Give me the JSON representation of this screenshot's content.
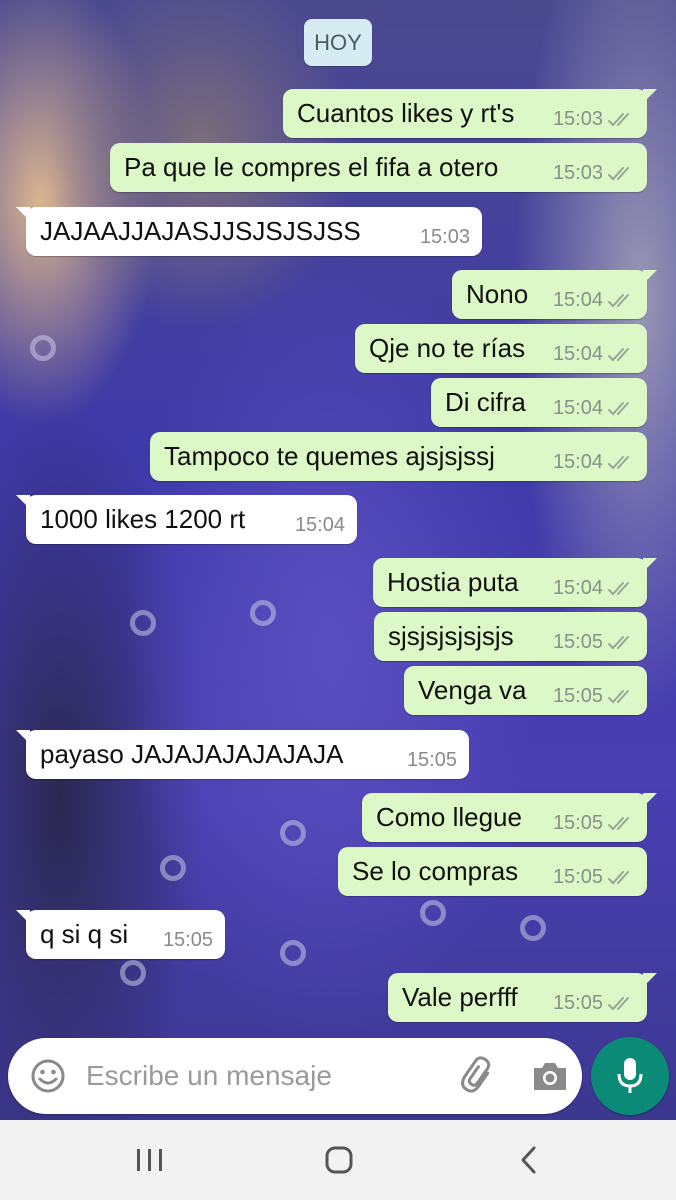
{
  "date_chip": "HOY",
  "messages": [
    {
      "dir": "out",
      "text": "Cuantos likes y rt's",
      "time": "15:03"
    },
    {
      "dir": "out",
      "text": "Pa que le compres el fifa a otero",
      "time": "15:03"
    },
    {
      "dir": "in",
      "text": "JAJAAJJAJASJJSJSJSJSS",
      "time": "15:03"
    },
    {
      "dir": "out",
      "text": "Nono",
      "time": "15:04"
    },
    {
      "dir": "out",
      "text": "Qje no te rías",
      "time": "15:04"
    },
    {
      "dir": "out",
      "text": "Di cifra",
      "time": "15:04"
    },
    {
      "dir": "out",
      "text": "Tampoco te quemes ajsjsjssj",
      "time": "15:04"
    },
    {
      "dir": "in",
      "text": "1000 likes 1200 rt",
      "time": "15:04"
    },
    {
      "dir": "out",
      "text": "Hostia puta",
      "time": "15:04"
    },
    {
      "dir": "out",
      "text": "sjsjsjsjsjsjs",
      "time": "15:05"
    },
    {
      "dir": "out",
      "text": "Venga va",
      "time": "15:05"
    },
    {
      "dir": "in",
      "text": "payaso JAJAJAJAJAJAJA",
      "time": "15:05"
    },
    {
      "dir": "out",
      "text": "Como llegue",
      "time": "15:05"
    },
    {
      "dir": "out",
      "text": "Se lo compras",
      "time": "15:05"
    },
    {
      "dir": "in",
      "text": "q si q si",
      "time": "15:05"
    },
    {
      "dir": "out",
      "text": "Vale perfff",
      "time": "15:05"
    }
  ],
  "composer": {
    "placeholder": "Escribe un mensaje",
    "icons": [
      "emoji-icon",
      "attach-icon",
      "camera-icon"
    ],
    "send_icon": "microphone-icon"
  },
  "navigation": {
    "icons": [
      "recent-apps-icon",
      "home-icon",
      "back-icon"
    ]
  },
  "colors": {
    "outgoing_bubble": "#dcf8c6",
    "incoming_bubble": "#ffffff",
    "date_chip": "#d7ebf3",
    "mic_button": "#0b8a77",
    "read_ticks": "#9aa59a"
  }
}
